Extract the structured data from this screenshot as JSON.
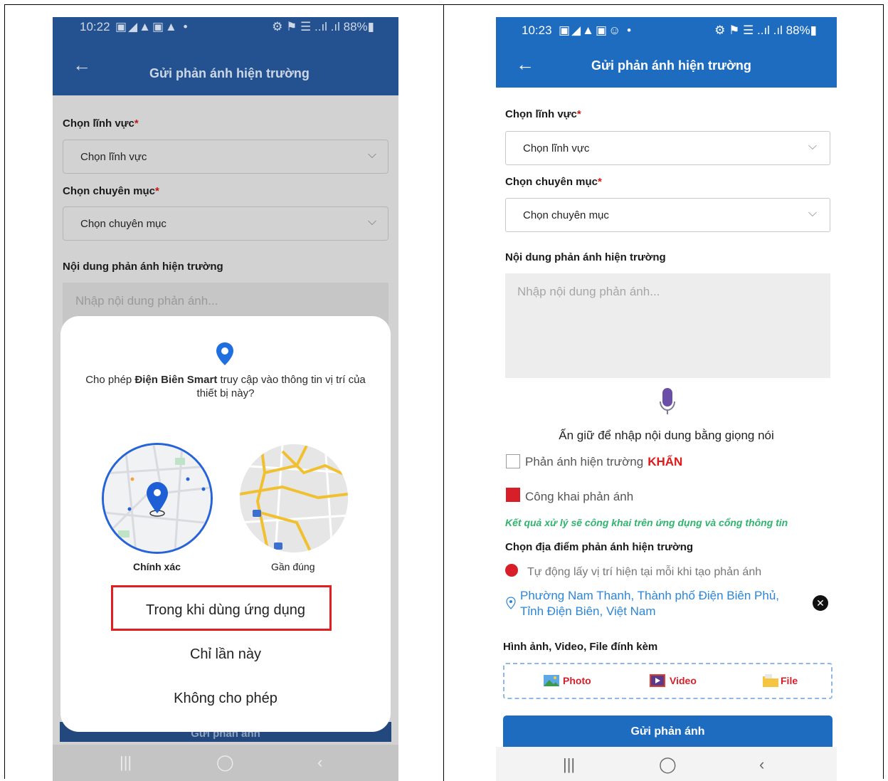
{
  "left": {
    "status": {
      "time": "10:22",
      "icons": "▣◢▲▣▲ •",
      "right": "⚙ ⚑ ☰ ..ıl .ıl 88%▮"
    },
    "appbar": {
      "back": "←",
      "title": "Gửi phản ánh hiện trường"
    },
    "field_label": "Chọn lĩnh vực",
    "field_value": "Chọn lĩnh vực",
    "category_label": "Chọn chuyên mục",
    "category_value": "Chọn chuyên mục",
    "required_mark": "*",
    "content_label": "Nội dung phản ánh hiện trường",
    "content_placeholder": "Nhập nội dung phản ánh...",
    "submit_label": "Gửi phản ánh",
    "dialog": {
      "question_pre": "Cho phép ",
      "question_app": "Điện Biên Smart",
      "question_post": " truy cập vào thông tin vị trí của thiết bị này?",
      "precise": "Chính xác",
      "approximate": "Gần đúng",
      "while_using": "Trong khi dùng ứng dụng",
      "only_this_time": "Chỉ lần này",
      "deny": "Không cho phép"
    },
    "nav": {
      "recent": "|||",
      "home": "◯",
      "back": "‹"
    }
  },
  "right": {
    "status": {
      "time": "10:23",
      "icons": "▣◢▲▣☺ •",
      "right": "⚙ ⚑ ☰ ..ıl .ıl 88%▮"
    },
    "appbar": {
      "back": "←",
      "title": "Gửi phản ánh hiện trường"
    },
    "field_label": "Chọn lĩnh vực",
    "field_value": "Chọn lĩnh vực",
    "category_label": "Chọn chuyên mục",
    "category_value": "Chọn chuyên mục",
    "required_mark": "*",
    "content_label": "Nội dung phản ánh hiện trường",
    "content_placeholder": "Nhập nội dung phản ánh...",
    "voice_hint": "Ấn giữ để nhập nội dung bằng giọng nói",
    "urgent_text": "Phản ánh hiện trường",
    "urgent_flag": "KHẨN",
    "urgent_checked": false,
    "public_text": "Công khai phản ánh",
    "public_checked": true,
    "public_note": "Kết quả xử lý sẽ công khai trên ứng dụng và cổng thông tin",
    "location_label": "Chọn địa điểm phản ánh hiện trường",
    "auto_location": "Tự động lấy vị trí hiện tại mỗi khi tạo phản ánh",
    "address": "Phường Nam Thanh, Thành phố Điện Biên Phủ, Tỉnh Điện Biên, Việt Nam",
    "clear_icon": "✕",
    "attach_label": "Hình ảnh, Video, File đính kèm",
    "photo": "Photo",
    "video": "Video",
    "file": "File",
    "submit_label": "Gửi phản ánh",
    "nav": {
      "recent": "|||",
      "home": "◯",
      "back": "‹"
    }
  },
  "colors": {
    "primary": "#1e6cc0",
    "dimmed_primary": "#24518f",
    "required": "#d01818",
    "highlight_box": "#e21e1e",
    "note_green": "#2fb46e",
    "link_blue": "#2c86d8"
  }
}
